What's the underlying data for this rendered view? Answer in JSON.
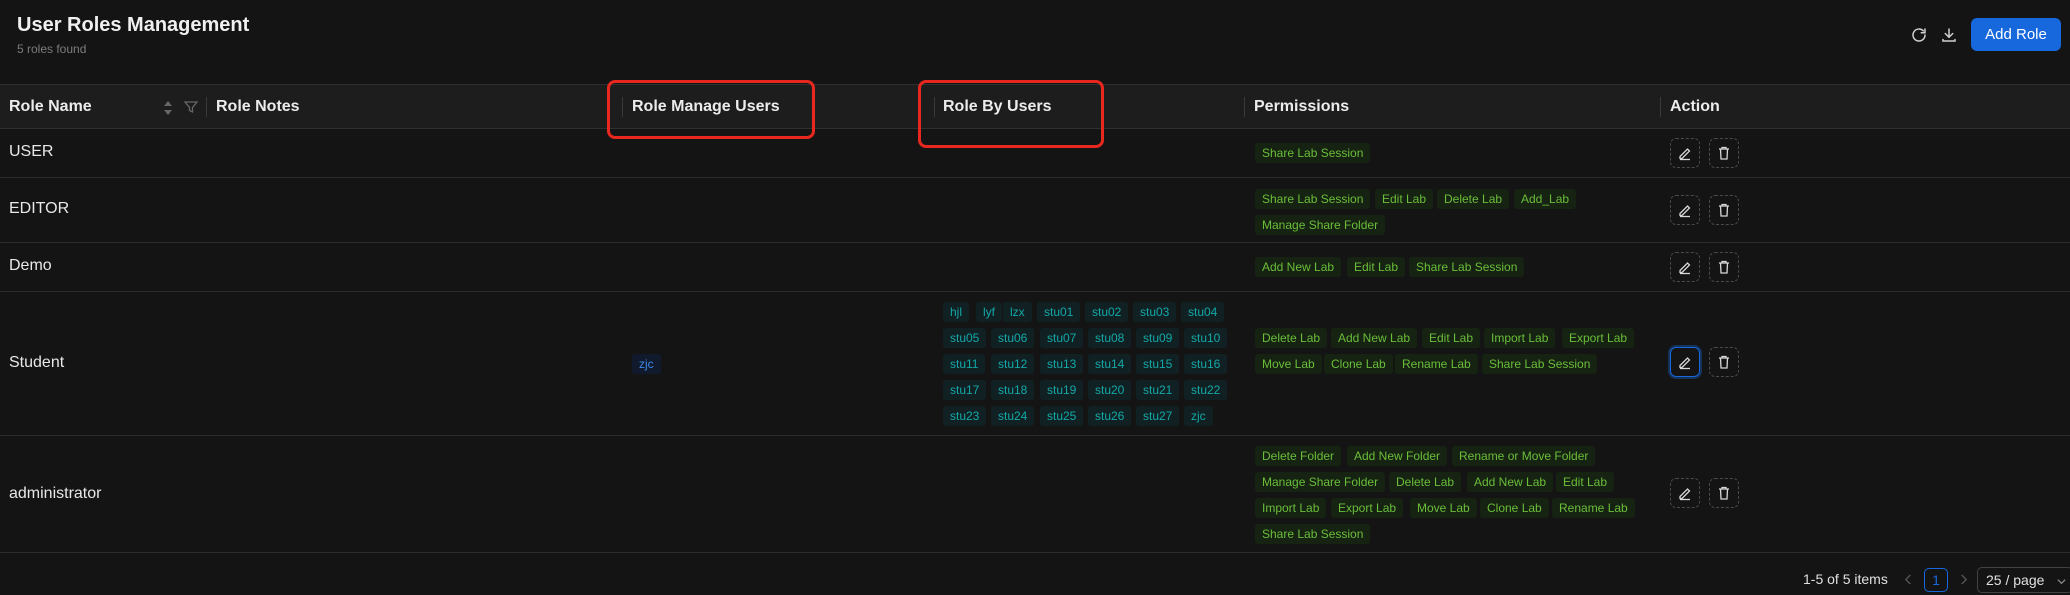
{
  "header": {
    "title": "User Roles Management",
    "subtitle": "5 roles found",
    "add_button": "Add Role"
  },
  "columns": {
    "role_name": "Role Name",
    "role_notes": "Role Notes",
    "role_manage_users": "Role Manage Users",
    "role_by_users": "Role By Users",
    "permissions": "Permissions",
    "action": "Action"
  },
  "rows": [
    {
      "name": "USER",
      "notes": "",
      "manage_users": [],
      "by_users": [],
      "permissions": [
        "Share Lab Session"
      ]
    },
    {
      "name": "EDITOR",
      "notes": "",
      "manage_users": [],
      "by_users": [],
      "permissions": [
        "Share Lab Session",
        "Edit Lab",
        "Delete Lab",
        "Add_Lab",
        "Manage Share Folder"
      ]
    },
    {
      "name": "Demo",
      "notes": "",
      "manage_users": [],
      "by_users": [],
      "permissions": [
        "Add New Lab",
        "Edit Lab",
        "Share Lab Session"
      ]
    },
    {
      "name": "Student",
      "notes": "",
      "manage_users": [
        "zjc"
      ],
      "by_users": [
        "hjl",
        "lyf",
        "lzx",
        "stu01",
        "stu02",
        "stu03",
        "stu04",
        "stu05",
        "stu06",
        "stu07",
        "stu08",
        "stu09",
        "stu10",
        "stu11",
        "stu12",
        "stu13",
        "stu14",
        "stu15",
        "stu16",
        "stu17",
        "stu18",
        "stu19",
        "stu20",
        "stu21",
        "stu22",
        "stu23",
        "stu24",
        "stu25",
        "stu26",
        "stu27",
        "zjc"
      ],
      "permissions": [
        "Delete Lab",
        "Add New Lab",
        "Edit Lab",
        "Import Lab",
        "Export Lab",
        "Move Lab",
        "Clone Lab",
        "Rename Lab",
        "Share Lab Session"
      ]
    },
    {
      "name": "administrator",
      "notes": "",
      "manage_users": [],
      "by_users": [],
      "permissions": [
        "Delete Folder",
        "Add New Folder",
        "Rename or Move Folder",
        "Manage Share Folder",
        "Delete Lab",
        "Add New Lab",
        "Edit Lab",
        "Import Lab",
        "Export Lab",
        "Move Lab",
        "Clone Lab",
        "Rename Lab",
        "Share Lab Session"
      ]
    }
  ],
  "pagination": {
    "summary": "1-5 of 5 items",
    "current_page": "1",
    "page_size": "25 / page"
  },
  "colors": {
    "accent": "#1668dc",
    "annotation": "#e8271f",
    "permission_tag": "#6abe39",
    "user_tag": "#13a8a8",
    "manager_tag": "#3c89e8"
  }
}
